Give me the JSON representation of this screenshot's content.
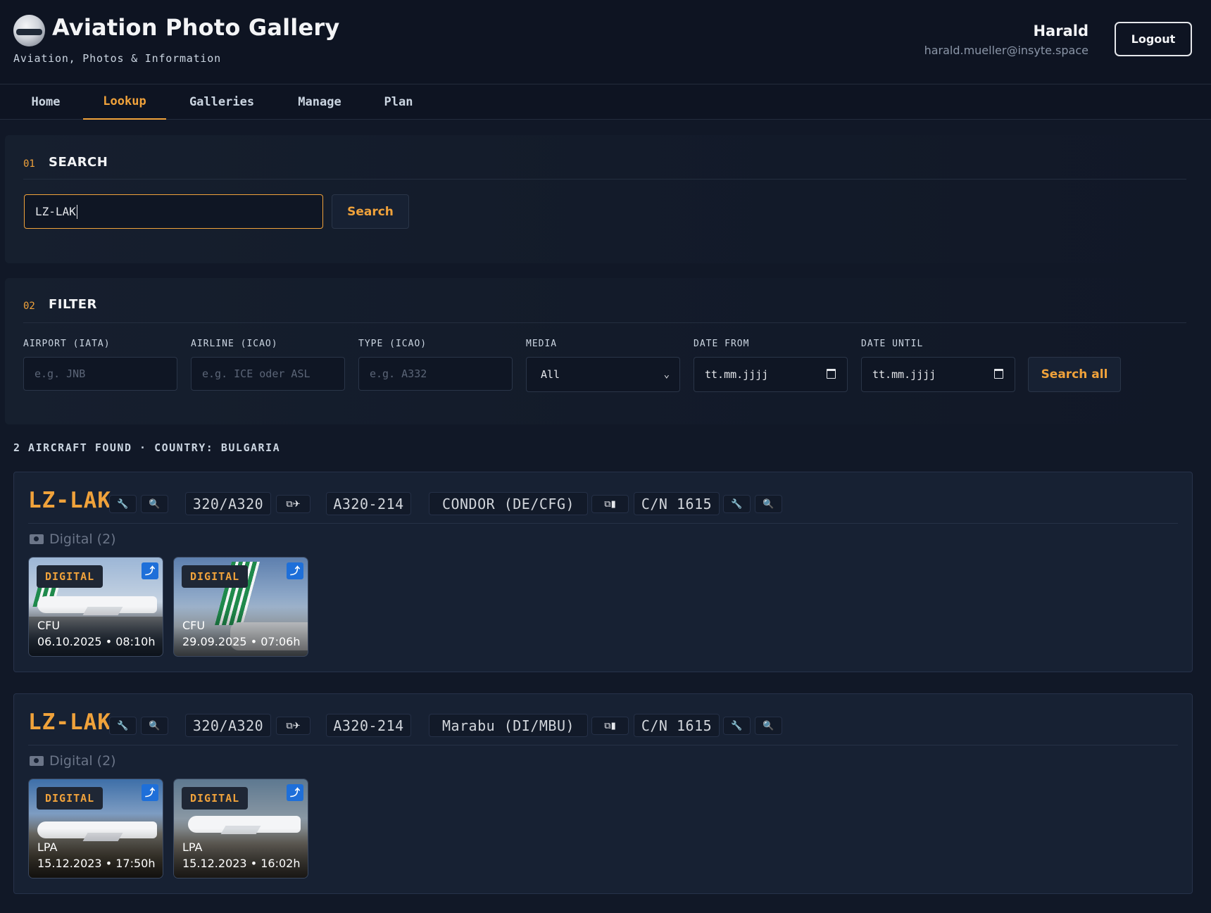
{
  "app": {
    "title": "Aviation Photo Gallery",
    "subtitle": "Aviation, Photos & Information"
  },
  "user": {
    "name": "Harald",
    "email": "harald.mueller@insyte.space",
    "logout_label": "Logout"
  },
  "nav": {
    "tabs": [
      {
        "label": "Home"
      },
      {
        "label": "Lookup",
        "active": true
      },
      {
        "label": "Galleries"
      },
      {
        "label": "Manage"
      },
      {
        "label": "Plan"
      }
    ]
  },
  "search": {
    "number": "01",
    "title": "SEARCH",
    "value": "LZ-LAK",
    "button_label": "Search"
  },
  "filter": {
    "number": "02",
    "title": "FILTER",
    "airport": {
      "label": "AIRPORT (IATA)",
      "placeholder": "e.g. JNB"
    },
    "airline": {
      "label": "AIRLINE (ICAO)",
      "placeholder": "e.g. ICE oder ASL"
    },
    "type": {
      "label": "TYPE (ICAO)",
      "placeholder": "e.g. A332"
    },
    "media": {
      "label": "MEDIA",
      "value": "All"
    },
    "date_from": {
      "label": "DATE FROM",
      "value": "tt.mm.jjjj"
    },
    "date_until": {
      "label": "DATE UNTIL",
      "value": "tt.mm.jjjj"
    },
    "search_all_label": "Search all"
  },
  "results": {
    "summary": "2 AIRCRAFT FOUND · COUNTRY: BULGARIA",
    "aircraft": [
      {
        "registration": "LZ-LAK",
        "type_code": "320/A320",
        "model": "A320-214",
        "operator": "CONDOR (DE/CFG)",
        "cn": "C/N 1615",
        "media_heading": "Digital (2)",
        "photos": [
          {
            "badge": "DIGITAL",
            "airport": "CFU",
            "datetime": "06.10.2025 • 08:10h"
          },
          {
            "badge": "DIGITAL",
            "airport": "CFU",
            "datetime": "29.09.2025 • 07:06h"
          }
        ]
      },
      {
        "registration": "LZ-LAK",
        "type_code": "320/A320",
        "model": "A320-214",
        "operator": "Marabu (DI/MBU)",
        "cn": "C/N 1615",
        "media_heading": "Digital (2)",
        "photos": [
          {
            "badge": "DIGITAL",
            "airport": "LPA",
            "datetime": "15.12.2023 • 17:50h"
          },
          {
            "badge": "DIGITAL",
            "airport": "LPA",
            "datetime": "15.12.2023 • 16:02h"
          }
        ]
      }
    ]
  },
  "icons": {
    "wrench": "🔧",
    "magnifier": "🔍",
    "copy_plane": "⧉✈",
    "copy_building": "⧉▮",
    "share": "⤴",
    "camera": "camera-icon",
    "calendar": "calendar-icon",
    "chevron": "⌄"
  },
  "colors": {
    "accent": "#f0a23b",
    "background": "#111827",
    "card": "#172133",
    "share_badge": "#1e6fd9"
  }
}
